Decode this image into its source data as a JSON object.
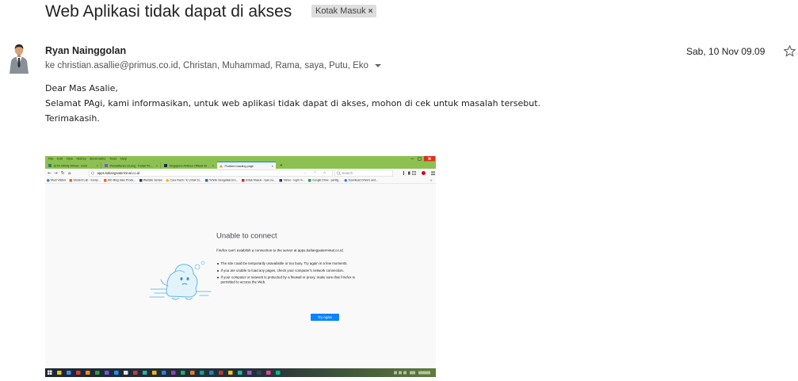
{
  "email": {
    "subject": "Web Aplikasi tidak dapat di akses",
    "label": "Kotak Masuk",
    "label_remove": "×",
    "sender_name": "Ryan Nainggolan",
    "recipients": "ke christian.asallie@primus.co.id, Christan, Muhammad, Rama, saya, Putu, Eko",
    "date": "Sab, 10 Nov 09.09",
    "body": [
      "Dear Mas Asalie,",
      "Selamat PAgi, kami informasikan, untuk web aplikasi tidak dapat di akses, mohon di cek untuk masalah tersebut.",
      "Terimakasih."
    ]
  },
  "attachment": {
    "menu": [
      "File",
      "Edit",
      "View",
      "History",
      "Bookmarks",
      "Tools",
      "Help"
    ],
    "tabs": [
      {
        "label": "GITA Infinity Mimal - mobi",
        "close": "×"
      },
      {
        "label": "Pendaftaran ULang - Kotak Pen...",
        "close": "×"
      },
      {
        "label": "Singapore Airlines Official W...",
        "close": "×"
      },
      {
        "label": "Problem loading page",
        "close": "×"
      }
    ],
    "new_tab": "+",
    "url": "apps.kaliangsaterminal.co.id",
    "url_actions": "···",
    "url_heart": "♡",
    "url_star": "☆",
    "search_placeholder": "Search",
    "nav": {
      "back": "←",
      "forward": "→",
      "reload": "↻",
      "home": "⌂"
    },
    "bookmarks": [
      "Most Visited",
      "Student Lab - Kemp...",
      "SID Blog Halo Produ...",
      "Website Sensei",
      "Cara Flash / Ic Untuk Si...",
      "Tehnik mengatasi Ero...",
      "Kotak Masuk - ryan.na...",
      "Yahoo - login m...",
      "Google Drive - pentig...",
      "Download Drivers and..."
    ],
    "bookmarks_more": "»",
    "error": {
      "title": "Unable to connect",
      "intro": "Firefox can’t establish a connection to the server at apps.kaliangsaterminal.co.id.",
      "bullets": [
        "The site could be temporarily unavailable or too busy. Try again in a few moments.",
        "If you are unable to load any pages, check your computer’s network connection.",
        "If your computer or network is protected by a firewall or proxy, make sure that Firefox is permitted to access the Web."
      ],
      "button": "Try Again"
    },
    "taskbar_icon_colors": [
      "#f0c419",
      "#3c8ee8",
      "#d83b2c",
      "#f08a24",
      "#2f9e44",
      "#6b5bd6",
      "#1e90ff",
      "#e5e5e5",
      "#c43c3c",
      "#2bb3a3",
      "#ffb300",
      "#3a7bd5",
      "#8e44ad",
      "#27ae60",
      "#e67e22",
      "#16a085",
      "#2980b9",
      "#c0392b",
      "#f1c40f",
      "#1abc9c",
      "#9b59b6",
      "#34495e",
      "#e84393",
      "#00b894"
    ]
  },
  "icons": {
    "avatar": "person-avatar",
    "star": "star-outline-icon",
    "caret": "chevron-down-icon",
    "firefox_window": [
      "minimize-icon",
      "maximize-icon",
      "close-icon"
    ],
    "toolbar": [
      "library-icon",
      "sidebar-icon",
      "alert-icon",
      "hamburger-menu-icon"
    ]
  },
  "colors": {
    "firefox_frame": "#8cc152",
    "try_again_button": "#0a84ff",
    "close_button": "#e0301e",
    "label_chip": "#dddddd",
    "tab_favicons": [
      "#2e7d6b",
      "#7b57c8",
      "#1b2a4a",
      "#f0a020"
    ],
    "bookmark_favicons": [
      "#3b7ddd",
      "#e36b1f",
      "#e36b1f",
      "#2c3e50",
      "#f0b400",
      "#2c6fb5",
      "#2c6fb5",
      "#c23321",
      "#4b1fa8",
      "#1aa260",
      "#3b7ddd"
    ]
  }
}
